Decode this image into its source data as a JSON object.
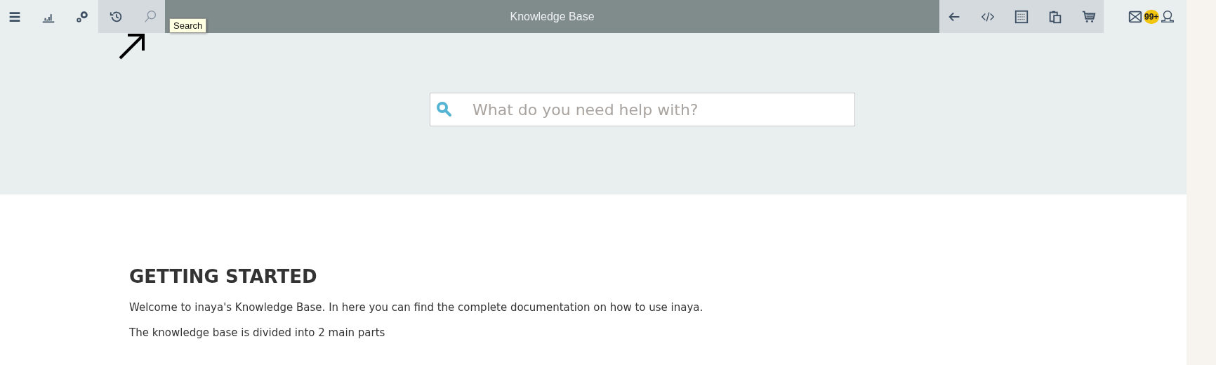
{
  "window": {
    "title": "Knowledge Base"
  },
  "tooltip": {
    "text": "Search"
  },
  "notifications": {
    "badge": "99+"
  },
  "search": {
    "placeholder": "What do you need help with?"
  },
  "article": {
    "heading": "GETTING STARTED",
    "paragraphs": [
      "Welcome to inaya's Knowledge Base. In here you can find the complete documentation on how to use inaya.",
      "The knowledge base is divided into 2 main parts"
    ]
  }
}
